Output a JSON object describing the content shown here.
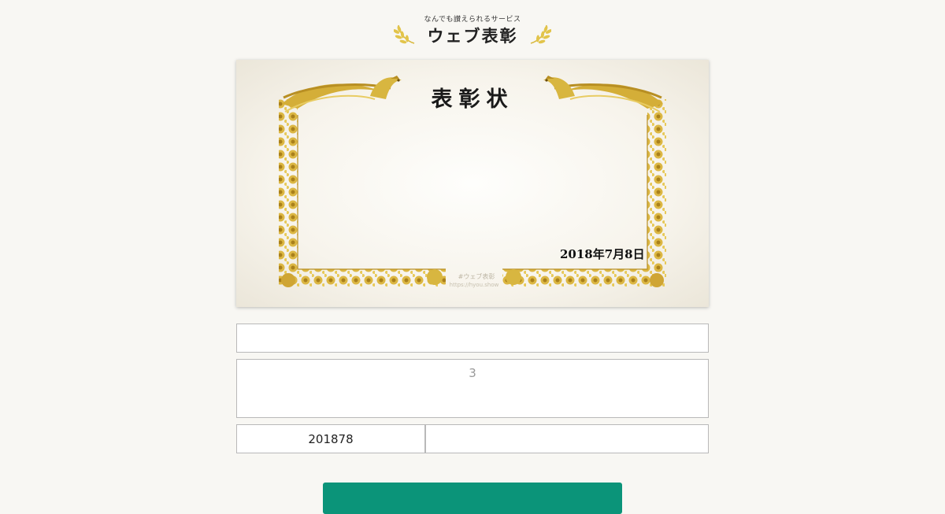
{
  "header": {
    "tagline": "なんでも讃えられるサービス",
    "title": "ウェブ表彰",
    "icons": [
      "laurel-left-icon",
      "laurel-right-icon"
    ]
  },
  "certificate": {
    "title": "表彰状",
    "date": "2018年7月8日",
    "watermark": "#ウェブ表彰",
    "watermark_url": "https://hyou.show",
    "frame_color": "#c9a227"
  },
  "form": {
    "name_value": "",
    "body_value": "3",
    "date_value": "201878",
    "signer_value": ""
  },
  "actions": {
    "submit_label": ""
  },
  "colors": {
    "accent": "#0b9479",
    "gold": "#c9a227",
    "background": "#f8f7f3"
  }
}
